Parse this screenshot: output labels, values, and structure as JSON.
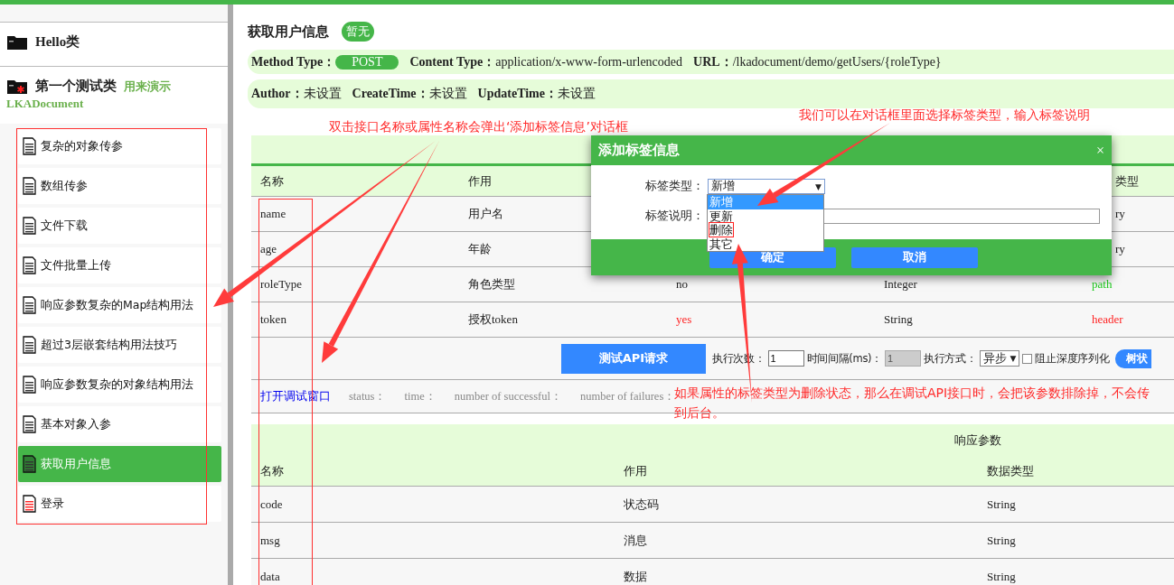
{
  "sidebar": {
    "classes": [
      {
        "name": "Hello类",
        "kind": "plain"
      },
      {
        "name": "第一个测试类",
        "note": "用来演示",
        "note_line_2": "LKADocument",
        "kind": "flagged"
      }
    ],
    "methods": [
      {
        "label": "复杂的对象传参",
        "selected": false,
        "color": "#333333"
      },
      {
        "label": "数组传参",
        "selected": false,
        "color": "#333333"
      },
      {
        "label": "文件下载",
        "selected": false,
        "color": "#333333"
      },
      {
        "label": "文件批量上传",
        "selected": false,
        "color": "#333333"
      },
      {
        "label": "响应参数复杂的Map结构用法",
        "selected": false,
        "color": "#333333"
      },
      {
        "label": "超过3层嵌套结构用法技巧",
        "selected": false,
        "color": "#333333"
      },
      {
        "label": "响应参数复杂的对象结构用法",
        "selected": false,
        "color": "#333333"
      },
      {
        "label": "基本对象入参",
        "selected": false,
        "color": "#333333"
      },
      {
        "label": "获取用户信息",
        "selected": true,
        "color": "#333333"
      },
      {
        "label": "登录",
        "selected": false,
        "color": "#ff2222"
      }
    ]
  },
  "title": "获取用户信息",
  "status_badge": "暂无",
  "meta_rows": [
    [
      {
        "label": "Method Type：",
        "value": "POST",
        "kind": "badge"
      },
      {
        "label": "Content Type：",
        "value": "application/x-www-form-urlencoded",
        "kind": "text"
      },
      {
        "label": "URL：",
        "value": "/lkadocument/demo/getUsers/{roleType}",
        "kind": "text"
      }
    ],
    [
      {
        "label": "Author：",
        "value": "未设置",
        "kind": "text"
      },
      {
        "label": "CreateTime：",
        "value": "未设置",
        "kind": "text"
      },
      {
        "label": "UpdateTime：",
        "value": "未设置",
        "kind": "text"
      }
    ]
  ],
  "request_table": {
    "header": {
      "name": "名称",
      "purpose": "作用",
      "column_5": {
        "text": "类型",
        "clipped": true
      }
    },
    "rows": [
      {
        "name": "name",
        "purpose": "用户名",
        "column_5": {
          "text": "ry",
          "clipped": true
        }
      },
      {
        "name": "age",
        "purpose": "年龄",
        "column_5": {
          "text": "ry",
          "clipped": true
        }
      },
      {
        "name": "roleType",
        "purpose": "角色类型",
        "column_3": {
          "text": "no"
        },
        "column_4": {
          "text": "Integer"
        },
        "column_5": {
          "text": "path",
          "color": "#22cc22"
        }
      },
      {
        "name": "token",
        "purpose": "授权token",
        "column_3": {
          "text": "yes",
          "color": "#ff2222"
        },
        "column_4": {
          "text": "String"
        },
        "column_5": {
          "text": "header",
          "color": "#ff2222"
        }
      }
    ]
  },
  "toolbar": {
    "test_button": "测试API请求",
    "count_label": "执行次数：",
    "count_value": "1",
    "interval_label": "时间间隔(ms)：",
    "interval_value": "1",
    "interval_disabled": true,
    "mode_label": "执行方式：",
    "mode_value": "异步",
    "mode_caret": "▼",
    "deep_checkbox": {
      "label": "阻止深度序列化",
      "checked": false
    },
    "tree_button": "树状"
  },
  "debug": {
    "link": "打开调试窗口",
    "stats": [
      "status：",
      "time：",
      "number of successful：",
      "number of failures："
    ]
  },
  "response_table": {
    "title": "响应参数",
    "header": {
      "name": "名称",
      "purpose": "作用",
      "data_type": "数据类型"
    },
    "rows": [
      {
        "name": "code",
        "purpose": "状态码",
        "data_type": "String"
      },
      {
        "name": "msg",
        "purpose": "消息",
        "data_type": "String"
      },
      {
        "name": "data",
        "purpose": "数据",
        "data_type": "String"
      }
    ]
  },
  "dialog": {
    "title": "添加标签信息",
    "close": "×",
    "type_label": "标签类型：",
    "type_value": "新增",
    "type_caret": "▼",
    "options": [
      {
        "label": "新增",
        "selected": true,
        "marked": false
      },
      {
        "label": "更新",
        "selected": false,
        "marked": false
      },
      {
        "label": "删除",
        "selected": false,
        "marked": true
      },
      {
        "label": "其它",
        "selected": false,
        "marked": false
      }
    ],
    "desc_label": "标签说明：",
    "buttons": [
      "确定",
      "取消"
    ]
  },
  "annotations": [
    "双击接口名称或属性名称会弹出‘添加标签信息’对话框",
    "我们可以在对话框里面选择标签类型，输入标签说明",
    "如果属性的标签类型为删除状态，那么在调试API接口时，会把该参数排除掉，不会传到后台。"
  ]
}
